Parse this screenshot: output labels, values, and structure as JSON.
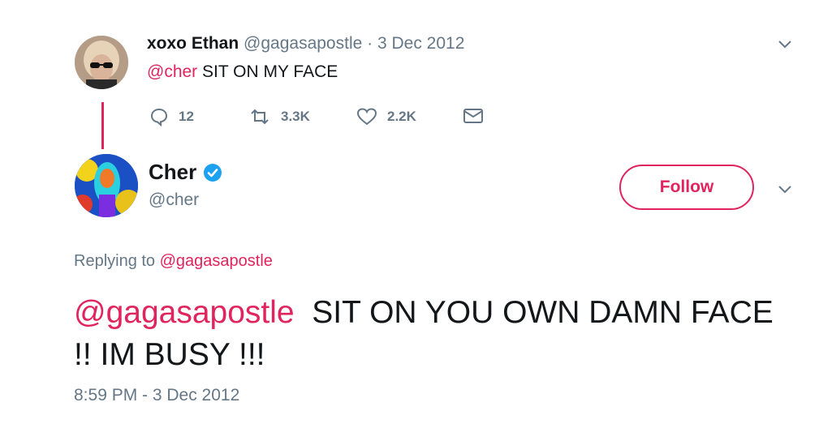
{
  "tweet1": {
    "name": "xoxo Ethan",
    "handle": "@gagasapostle",
    "separator": "·",
    "date": "3 Dec 2012",
    "mention": "@cher",
    "text": "SIT ON MY FACE",
    "actions": {
      "replies": "12",
      "retweets": "3.3K",
      "likes": "2.2K"
    }
  },
  "tweet2": {
    "name": "Cher",
    "handle": "@cher",
    "follow_label": "Follow",
    "replying_prefix": "Replying to",
    "replying_handle": "@gagasapostle",
    "mention": "@gagasapostle",
    "text": "SIT ON YOU OWN DAMN FACE !! IM BUSY !!!",
    "timestamp": "8:59 PM - 3 Dec 2012"
  },
  "colors": {
    "accent": "#e0245e",
    "muted": "#657786",
    "verified": "#1da1f2"
  }
}
